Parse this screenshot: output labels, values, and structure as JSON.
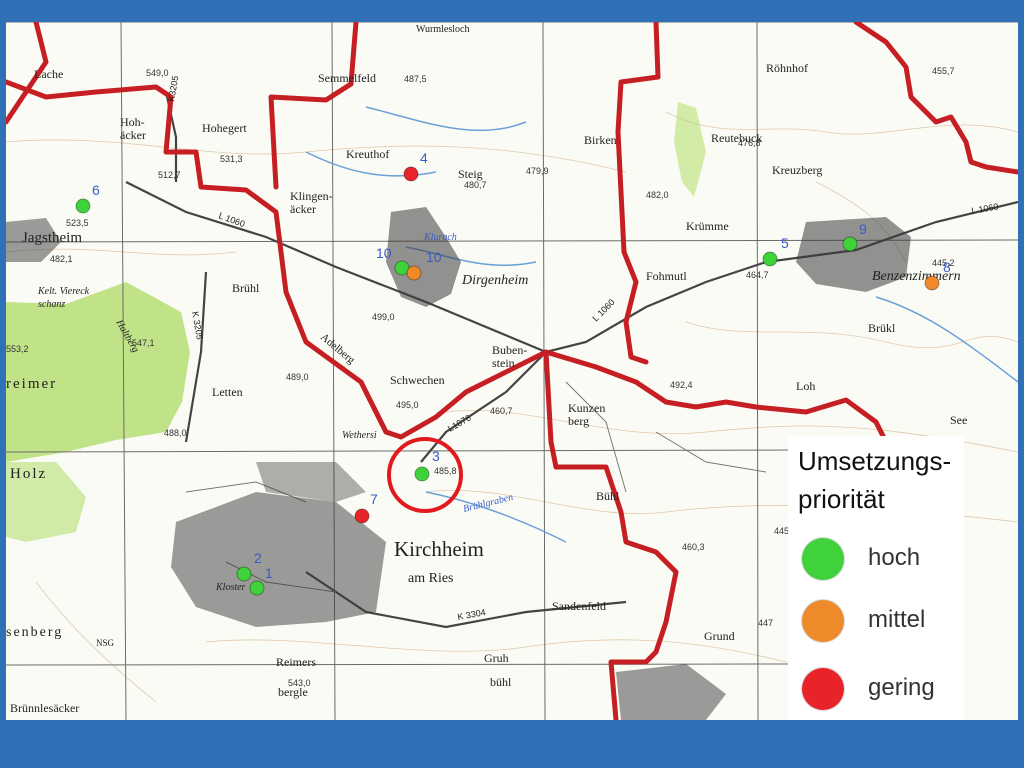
{
  "legend": {
    "title": "Umsetzungs-\npriorität",
    "items": [
      {
        "label": "hoch",
        "color": "#3fd23a"
      },
      {
        "label": "mittel",
        "color": "#ef8a2a"
      },
      {
        "label": "gering",
        "color": "#e8242a"
      }
    ]
  },
  "colors": {
    "frame": "#2f70b6",
    "boundary": "#c61f23",
    "forest": "#b8e07a",
    "roads": "#555555",
    "water": "#6a9fd8",
    "highlight_circle": "#e01a1e"
  },
  "places": {
    "kirchheim": "Kirchheim",
    "am_ries": "am Ries",
    "dirgenheim": "Dirgenheim",
    "benzenzimmern": "Benzenzimmern",
    "jagstheim": "Jagstheim",
    "lache": "Lache",
    "semmelfeld": "Semmelfeld",
    "hoheggert": "Hohegert",
    "hohaecker": "Hoh-\näcker",
    "klingenaecker": "Klingen-\näcker",
    "kreuthof": "Kreuthof",
    "steig": "Steig",
    "birken": "Birken",
    "reutebuck": "Reutebuck",
    "kreuzberg": "Kreuzberg",
    "kruemme": "Krümme",
    "rohnhof": "Röhnhof",
    "bruehl": "Brühl",
    "bruehl2": "Brükl",
    "fohmutl": "Fohmutl",
    "letten": "Letten",
    "adelberg": "Adelberg",
    "bubenstein": "Buben-\nstein",
    "schwechen": "Schwechen",
    "kunzenberg": "Kunzen\nberg",
    "buehl": "Bühl",
    "sandenfeld": "Sandenfeld",
    "grund": "Grund",
    "reimers": "Reimers",
    "bergle": "bergle",
    "gruh": "Gruh",
    "buehl3": "bühl",
    "holz": "Holz",
    "loh": "Loh",
    "see": "See",
    "bruennlesaecker": "Brünnlesäcker",
    "rieimer": "reimer",
    "wetherio": "Wethersi",
    "bruehlgraben": "Brühlgraben",
    "klingenbach": "Klurach",
    "wurmlesloch": "Wurmlesloch",
    "keltviereck": "Kelt. Viereck\nschanz",
    "haltberg": "Haltberg",
    "kloster": "Kloster",
    "osenberg": "senberg",
    "nsg": "NSG"
  },
  "roads": {
    "l1060_a": "L 1060",
    "l1060_b": "L 1060",
    "l1060_c": "L 1060",
    "l1076": "L1076",
    "k3205_a": "K3205",
    "k3205_b": "K 3205",
    "k3304": "K 3304"
  },
  "elevations": [
    "549,0",
    "487,5",
    "531,3",
    "512,7",
    "476,8",
    "479,9",
    "482,0",
    "455,7",
    "523,5",
    "553,2",
    "499,0",
    "489,0",
    "495,0",
    "460,7",
    "488,0",
    "485,8",
    "460,3",
    "447",
    "445,2",
    "464,7",
    "492,4",
    "480,7",
    "543,0",
    "445",
    "482,1",
    "547,1"
  ],
  "sites": [
    {
      "id": "1",
      "priority": "hoch",
      "color": "#3fd23a"
    },
    {
      "id": "2",
      "priority": "hoch",
      "color": "#3fd23a"
    },
    {
      "id": "3",
      "priority": "hoch",
      "color": "#3fd23a"
    },
    {
      "id": "4",
      "priority": "gering",
      "color": "#e8242a"
    },
    {
      "id": "5",
      "priority": "hoch",
      "color": "#3fd23a"
    },
    {
      "id": "6",
      "priority": "hoch",
      "color": "#3fd23a"
    },
    {
      "id": "7",
      "priority": "gering",
      "color": "#e8242a"
    },
    {
      "id": "8",
      "priority": "mittel",
      "color": "#ef8a2a"
    },
    {
      "id": "9",
      "priority": "hoch",
      "color": "#3fd23a"
    },
    {
      "id": "10",
      "priority": "hoch",
      "color": "#3fd23a"
    },
    {
      "id": "10",
      "priority": "mittel",
      "color": "#ef8a2a"
    }
  ],
  "highlighted_site": "3"
}
